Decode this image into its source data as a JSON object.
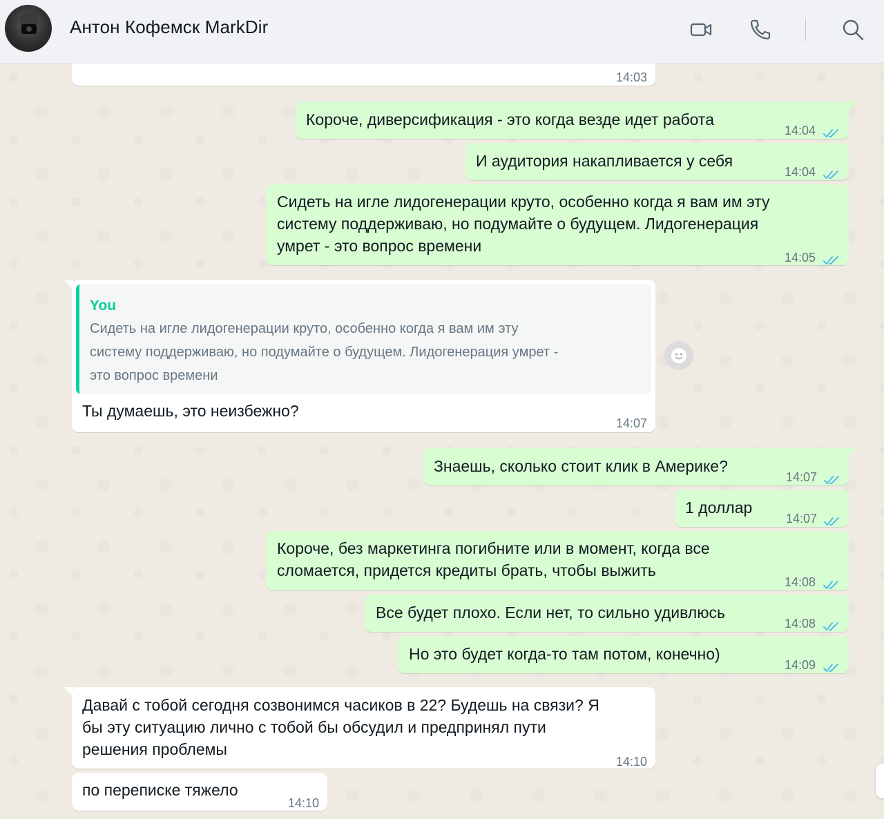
{
  "header": {
    "contact_name": "Антон Кофемск MarkDir",
    "icons": [
      "video-call-icon",
      "voice-call-icon",
      "search-icon"
    ]
  },
  "messages": [
    {
      "direction": "in",
      "text": "",
      "time": "14:03"
    },
    {
      "direction": "out",
      "text": "Короче, диверсификация - это когда везде идет работа",
      "time": "14:04",
      "status": "read"
    },
    {
      "direction": "out",
      "text": "И аудитория накапливается у себя",
      "time": "14:04",
      "status": "read"
    },
    {
      "direction": "out",
      "text": "Сидеть на игле лидогенерации круто, особенно когда я вам им эту\nсистему поддерживаю, но подумайте о будущем. Лидогенерация\nумрет - это вопрос времени",
      "time": "14:05",
      "status": "read"
    },
    {
      "direction": "in",
      "quote_author": "You",
      "quote_text": "Сидеть на игле лидогенерации круто, особенно когда я вам им эту\nсистему поддерживаю, но подумайте о будущем. Лидогенерация умрет -\nэто вопрос времени",
      "text": "Ты думаешь, это неизбежно?",
      "time": "14:07"
    },
    {
      "direction": "out",
      "text": "Знаешь, сколько стоит клик в Америке?",
      "time": "14:07",
      "status": "read"
    },
    {
      "direction": "out",
      "text": "1 доллар",
      "time": "14:07",
      "status": "read"
    },
    {
      "direction": "out",
      "text": "Короче, без маркетинга погибните или в момент, когда все\nсломается, придется кредиты брать, чтобы выжить",
      "time": "14:08",
      "status": "read"
    },
    {
      "direction": "out",
      "text": "Все будет плохо. Если нет, то сильно удивлюсь",
      "time": "14:08",
      "status": "read"
    },
    {
      "direction": "out",
      "text": "Но это будет когда-то там потом, конечно)",
      "time": "14:09",
      "status": "read"
    },
    {
      "direction": "in",
      "text": "Давай с тобой сегодня созвонимся часиков в 22? Будешь на связи? Я\nбы эту ситуацию лично с тобой бы обсудил и предпринял пути\nрешения проблемы",
      "time": "14:10"
    },
    {
      "direction": "in",
      "text": "по переписке тяжело",
      "time": "14:10"
    }
  ],
  "colors": {
    "incoming": "#ffffff",
    "outgoing": "#d9fdd3",
    "read_ticks": "#53bdeb",
    "quote_accent": "#06cf9c",
    "background": "#efeae2"
  }
}
